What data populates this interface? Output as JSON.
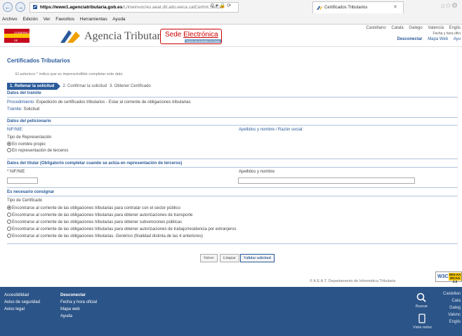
{
  "browser": {
    "url_host": "https://www1.agenciatributaria.gob.es",
    "url_path": "/L/inwinvoc/es.aeat.dit.adu.eeca.catCertInt.SelCe",
    "tab_title": "Certificados Tributarios",
    "menu": [
      "Archivo",
      "Edición",
      "Ver",
      "Favoritos",
      "Herramientas",
      "Ayuda"
    ]
  },
  "header": {
    "gov_logo_line1": "GOBIERNO",
    "gov_logo_line2": "DE ESPAÑA",
    "agency_name": "Agencia Tributaria",
    "sede_word1": "Sede ",
    "sede_word2": "Electrónica",
    "sede_sub": "Todos los trámites en línea",
    "languages": [
      "Castellano",
      "Català",
      "Galego",
      "Valencià",
      "Englis"
    ],
    "fecha": "Fecha y hora ofici",
    "links": [
      "Desconectar",
      "Mapa Web",
      "Ayu"
    ]
  },
  "page": {
    "title": "Certificados Tributarios",
    "asterisk_note": "El asterisco * indica que es imprescindible completar este dato",
    "steps": [
      "1. Rellenar la solicitud",
      "2. Confirmar la solicitud",
      "3. Obtener Certificado"
    ]
  },
  "tramite": {
    "title": "Datos del trámite",
    "procedimiento_label": "Procedimiento:",
    "procedimiento_value": " Expedición de certificados tributarios - Estar al corriente de obligaciones tributarias",
    "tramite_label": "Trámite:",
    "tramite_value": " Solicitud"
  },
  "peticionario": {
    "title": "Datos del peticionario",
    "nif_label": "NIF/NIE:",
    "nombre_label": "Apellidos y nombre / Razón social:",
    "tipo_label": "Tipo de Representación",
    "options": [
      "En nombre propio",
      "En representación de terceros"
    ],
    "selected": 0
  },
  "titular": {
    "title": "Datos del titular (Obligatorio completar cuando se actúa en representación de terceros)",
    "nif_label": "* NIF/NIE",
    "nombre_label": "Apellidos y nombre",
    "nif_value": "",
    "nombre_value": ""
  },
  "consignar": {
    "title": "Es necesario consignar",
    "tipo_label": "Tipo de Certificado",
    "options": [
      "Encontrarse al corriente de las obligaciones tributarias para contratar con el sector público",
      "Encontrarse al corriente de las obligaciones tributarias para obtener autorizaciones de transporte",
      "Encontrarse al corriente de las obligaciones tributarias para obtener subvenciones públicas",
      "Encontrarse al corriente de las obligaciones tributarias para obtener autorizaciones de trabajo/residencia por extranjeros",
      "Encontrarse al corriente de las obligaciones tributarias. Genérico (finalidad distinta de las 4 anteriores)"
    ],
    "selected": 0
  },
  "buttons": {
    "volver": "Volver",
    "limpiar": "Limpiar",
    "validar": "Validar solicitud"
  },
  "footer": {
    "dept": "© A.E.A.T. Departamento de Informática Tributaria",
    "wai_1": "W3C",
    "wai_2": "WAI-AA WCAG 2.0",
    "col1": [
      "Accesibilidad",
      "Aviso de seguridad",
      "Aviso legal"
    ],
    "col2_head": "Desconectar",
    "col2": [
      "Fecha y hora oficial",
      "Mapa web",
      "Ayuda"
    ],
    "buscar": "Buscar",
    "vista": "Vista reduc",
    "right": [
      "Castellan",
      "Cata",
      "Galeg",
      "Valenc",
      "Englis"
    ]
  }
}
